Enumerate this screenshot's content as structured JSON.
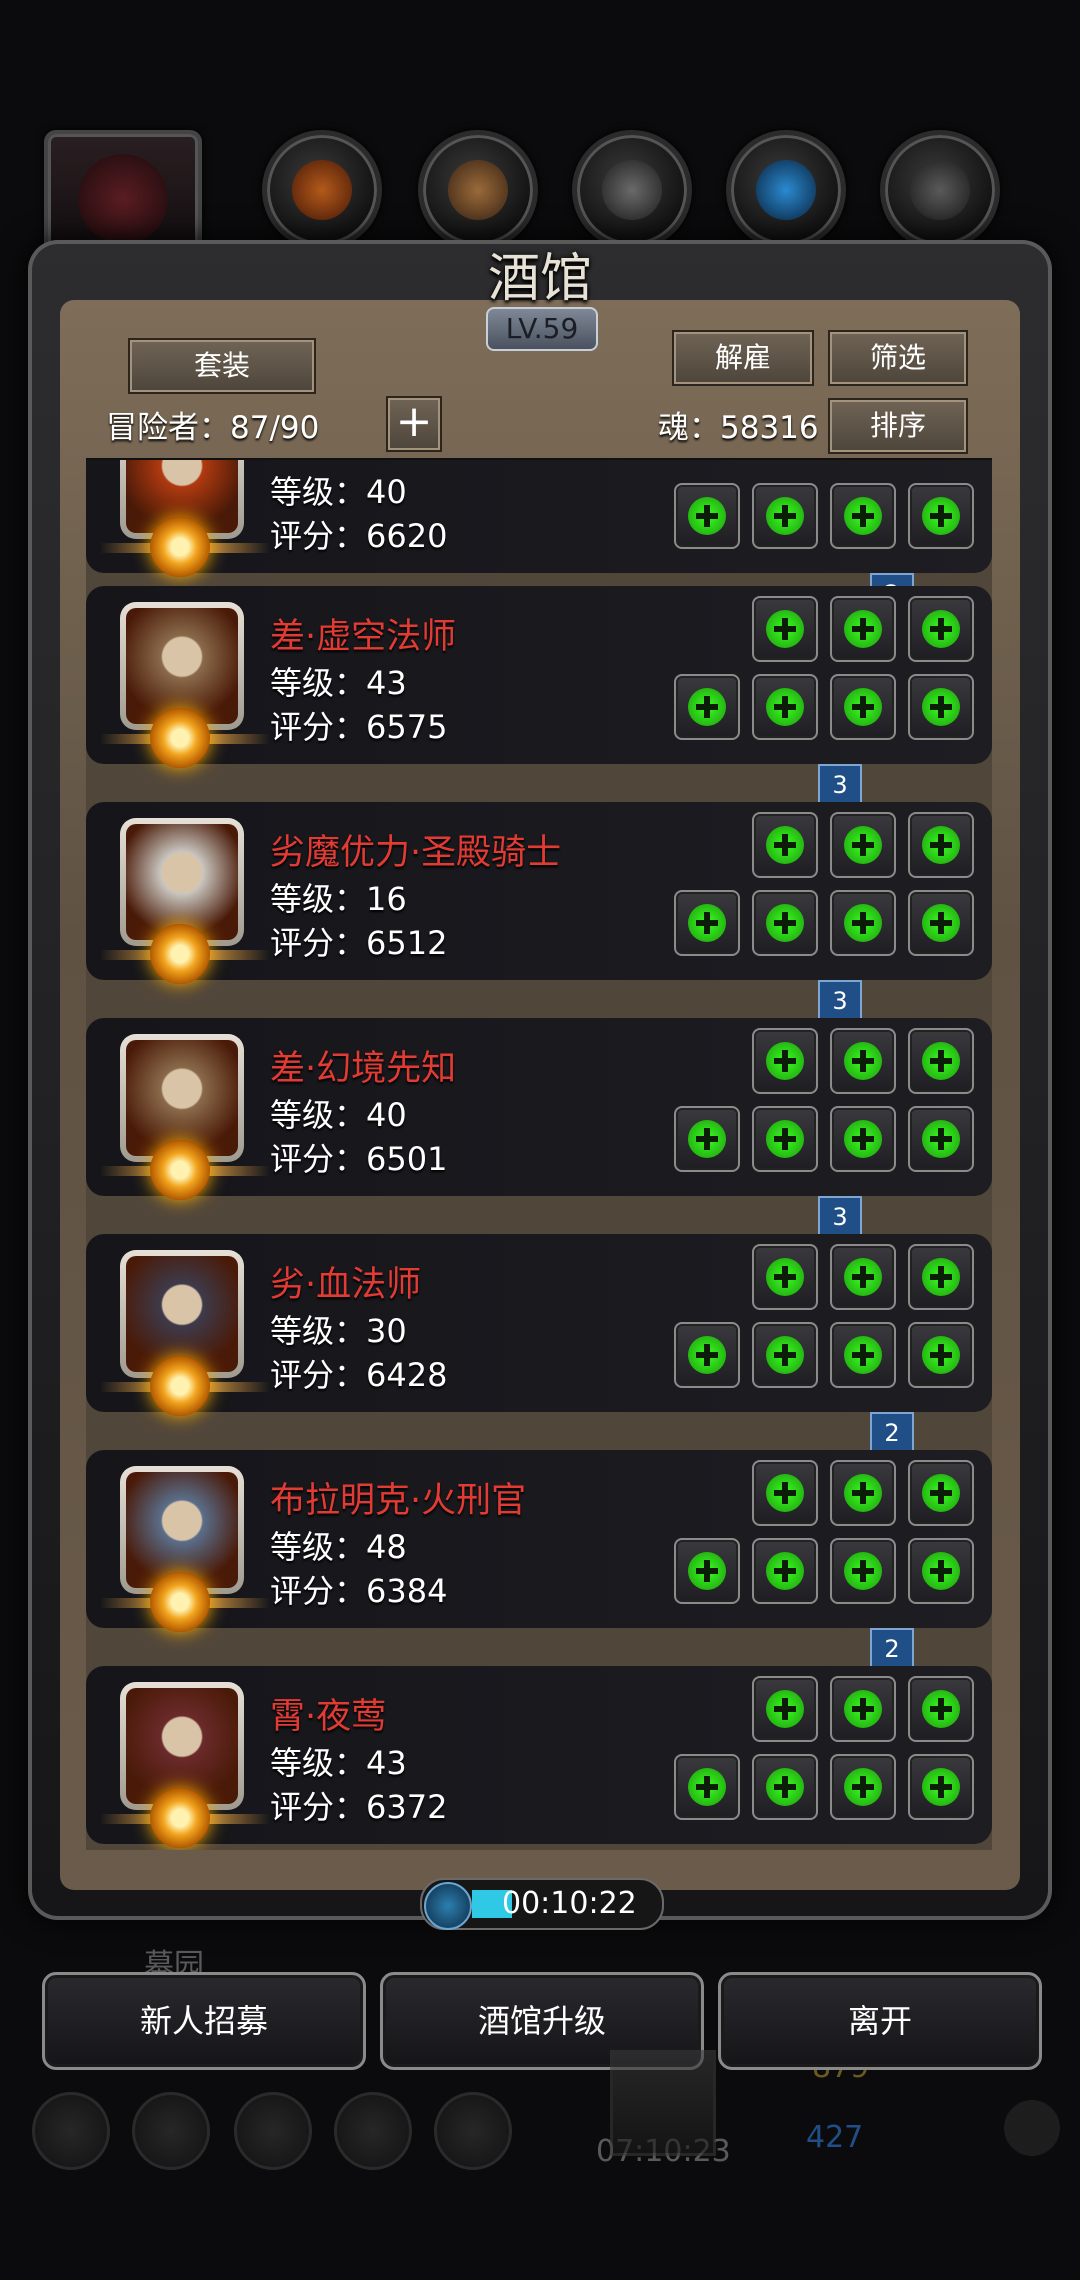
{
  "header": {
    "title": "酒馆",
    "level": "LV.59"
  },
  "toolbar": {
    "set_btn": "套装",
    "dismiss_btn": "解雇",
    "filter_btn": "筛选",
    "sort_btn": "排序",
    "adventurers_label": "冒险者：87/90",
    "soul_label": "魂：58316",
    "add_icon": "+"
  },
  "top_tabs": [
    "hero-icon",
    "shield-icon",
    "scroll-icon",
    "armor-icon",
    "wing-icon",
    "helmet-icon"
  ],
  "heroes": [
    {
      "name": "",
      "level": "等级：40",
      "score": "评分：6620",
      "top_slots": 0,
      "bottom_slots": 4,
      "rank": "2",
      "color": "#b03a10"
    },
    {
      "name": "差·虚空法师",
      "level": "等级：43",
      "score": "评分：6575",
      "top_slots": 3,
      "bottom_slots": 4,
      "rank": "3",
      "color": "#8a6a4a"
    },
    {
      "name": "劣魔优力·圣殿骑士",
      "level": "等级：16",
      "score": "评分：6512",
      "top_slots": 3,
      "bottom_slots": 4,
      "rank": "3",
      "color": "#c9c6bf"
    },
    {
      "name": "差·幻境先知",
      "level": "等级：40",
      "score": "评分：6501",
      "top_slots": 3,
      "bottom_slots": 4,
      "rank": "3",
      "color": "#8a6a4a"
    },
    {
      "name": "劣·血法师",
      "level": "等级：30",
      "score": "评分：6428",
      "top_slots": 3,
      "bottom_slots": 4,
      "rank": "2",
      "color": "#3e3a4a"
    },
    {
      "name": "布拉明克·火刑官",
      "level": "等级：48",
      "score": "评分：6384",
      "top_slots": 3,
      "bottom_slots": 4,
      "rank": "2",
      "color": "#5a6e8a"
    },
    {
      "name": "霄·夜莺",
      "level": "等级：43",
      "score": "评分：6372",
      "top_slots": 3,
      "bottom_slots": 4,
      "rank": "",
      "color": "#6a2a2a"
    }
  ],
  "timer": {
    "value": "00:10:22"
  },
  "bottom": {
    "recruit": "新人招募",
    "upgrade": "酒馆升级",
    "leave": "离开"
  },
  "background": {
    "graveyard": "墓园",
    "time": "07:10:23",
    "gold": "879",
    "gems": "427"
  }
}
